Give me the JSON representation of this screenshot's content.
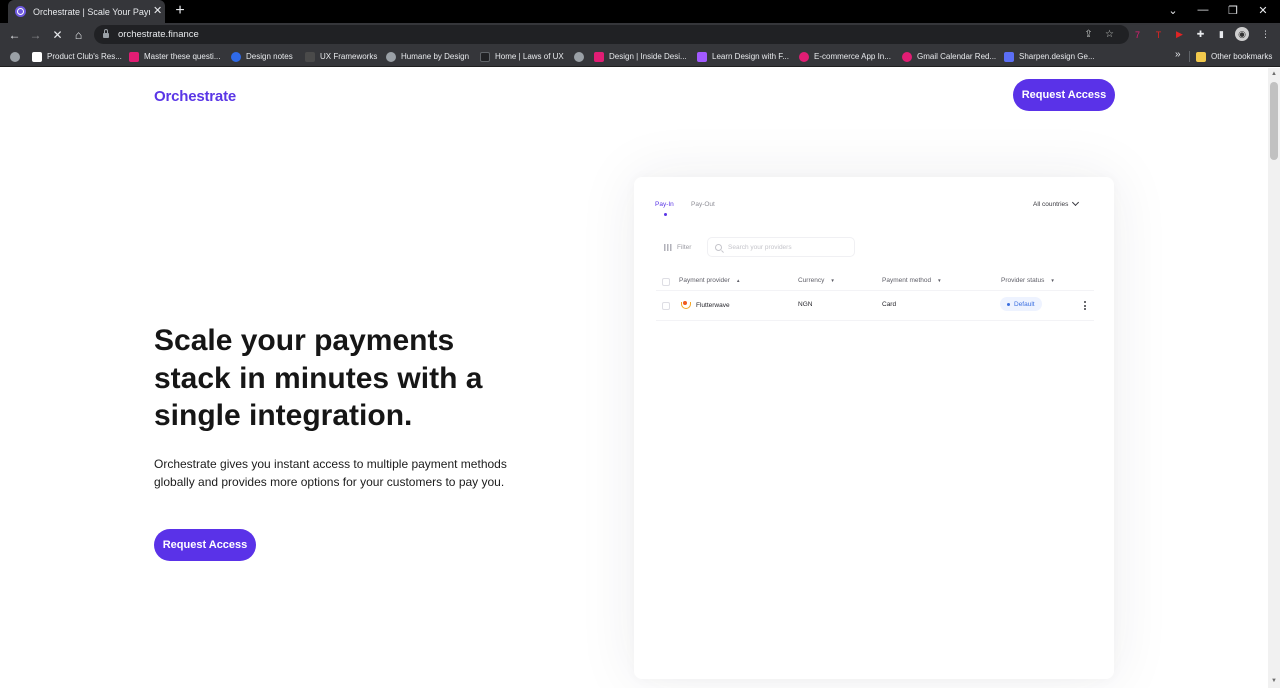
{
  "browser": {
    "tab_title": "Orchestrate | Scale Your Payments",
    "url": "orchestrate.finance",
    "bookmarks": [
      {
        "label": "Product Club's Res...",
        "color": "#ffffff"
      },
      {
        "label": "Master these questi...",
        "color": "#e11d74"
      },
      {
        "label": "Design notes",
        "color": "#2f6ae8"
      },
      {
        "label": "UX Frameworks",
        "color": "#4a4a4a"
      },
      {
        "label": "Humane by Design",
        "color": "#9aa0a6"
      },
      {
        "label": "Home | Laws of UX",
        "color": "#202124"
      },
      {
        "label": "",
        "color": "#9aa0a6"
      },
      {
        "label": "Design | Inside Desi...",
        "color": "#e11d74"
      },
      {
        "label": "Learn Design with F...",
        "color": "#a259ff"
      },
      {
        "label": "E-commerce App In...",
        "color": "#e11d74"
      },
      {
        "label": "Gmail Calendar Red...",
        "color": "#e11d74"
      },
      {
        "label": "Sharpen.design Ge...",
        "color": "#5b6ef5"
      }
    ],
    "other_bookmarks": "Other bookmarks"
  },
  "site": {
    "logo": "Orchestrate",
    "header_cta": "Request Access",
    "hero_title": "Scale your payments stack in minutes with a single integration.",
    "hero_subtitle": "Orchestrate gives you instant access to multiple payment methods globally and provides more options for your customers to pay you.",
    "hero_cta": "Request Access",
    "accent_color": "#5a32e8"
  },
  "dashboard": {
    "tabs": [
      "Pay-In",
      "Pay-Out"
    ],
    "active_tab": "Pay-In",
    "country_select": "All countries",
    "filter_label": "Filter",
    "search_placeholder": "Search your providers",
    "columns": [
      "Payment provider",
      "Currency",
      "Payment method",
      "Provider status"
    ],
    "rows": [
      {
        "provider": "Flutterwave",
        "currency": "NGN",
        "method": "Card",
        "status": "Default"
      }
    ]
  }
}
